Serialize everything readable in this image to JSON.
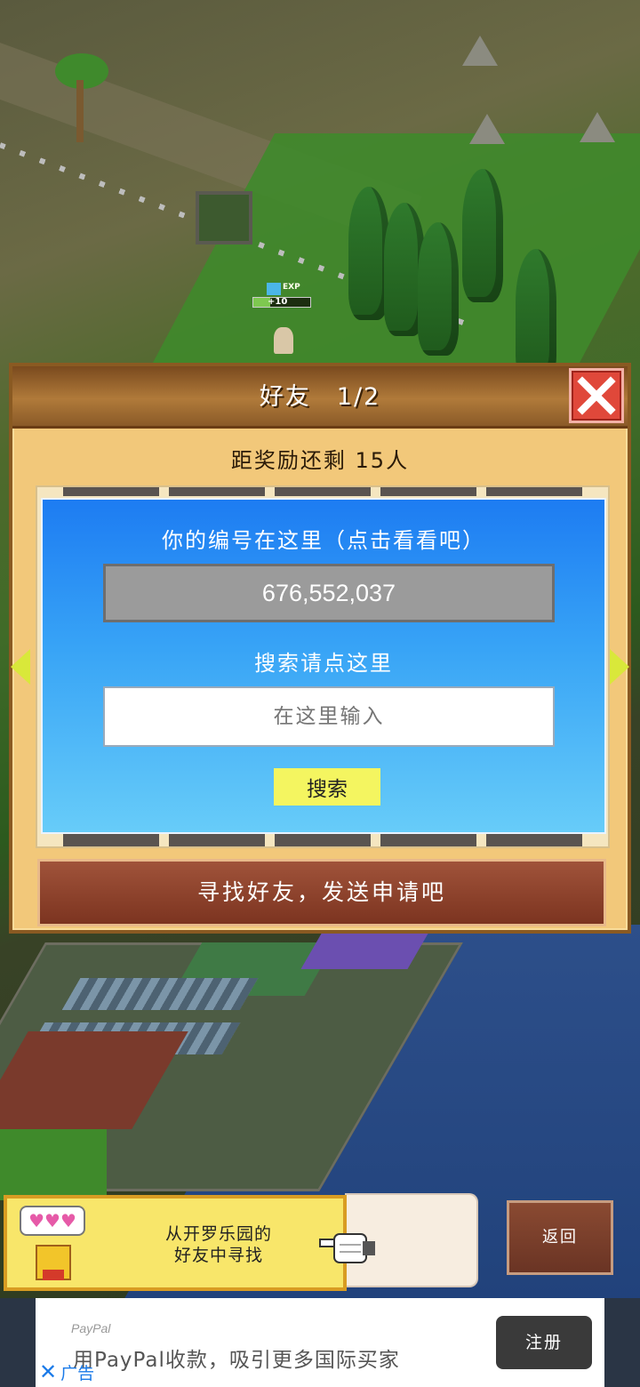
{
  "world": {
    "exp_popup": {
      "label": "EXP",
      "value": "+10"
    }
  },
  "dialog": {
    "title": "好友　1/2",
    "reward_text": "距奖励还剩 15人",
    "id_label": "你的编号在这里（点击看看吧）",
    "id_value": "676,552,037",
    "search_label": "搜索请点这里",
    "search_placeholder": "在这里输入",
    "search_button": "搜索",
    "send_button": "寻找好友，发送申请吧",
    "close_icon": "close-x-icon",
    "prev_icon": "arrow-left-icon",
    "next_icon": "arrow-right-icon"
  },
  "bottom": {
    "banner_text_line1": "从开罗乐园的",
    "banner_text_line2": "好友中寻找",
    "avatar_bubble": "♥♥♥",
    "back_button": "返回"
  },
  "ad": {
    "brand": "PayPal",
    "text": "用PayPal收款，吸引更多国际买家",
    "cta": "注册",
    "close_label": "广告"
  },
  "colors": {
    "dialog_bg": "#f2c87a",
    "header_brown": "#8a5a28",
    "close_red": "#e0483a",
    "panel_blue": "#1d7cf2",
    "search_yellow": "#f4f560",
    "send_brown": "#8c3f2a"
  }
}
